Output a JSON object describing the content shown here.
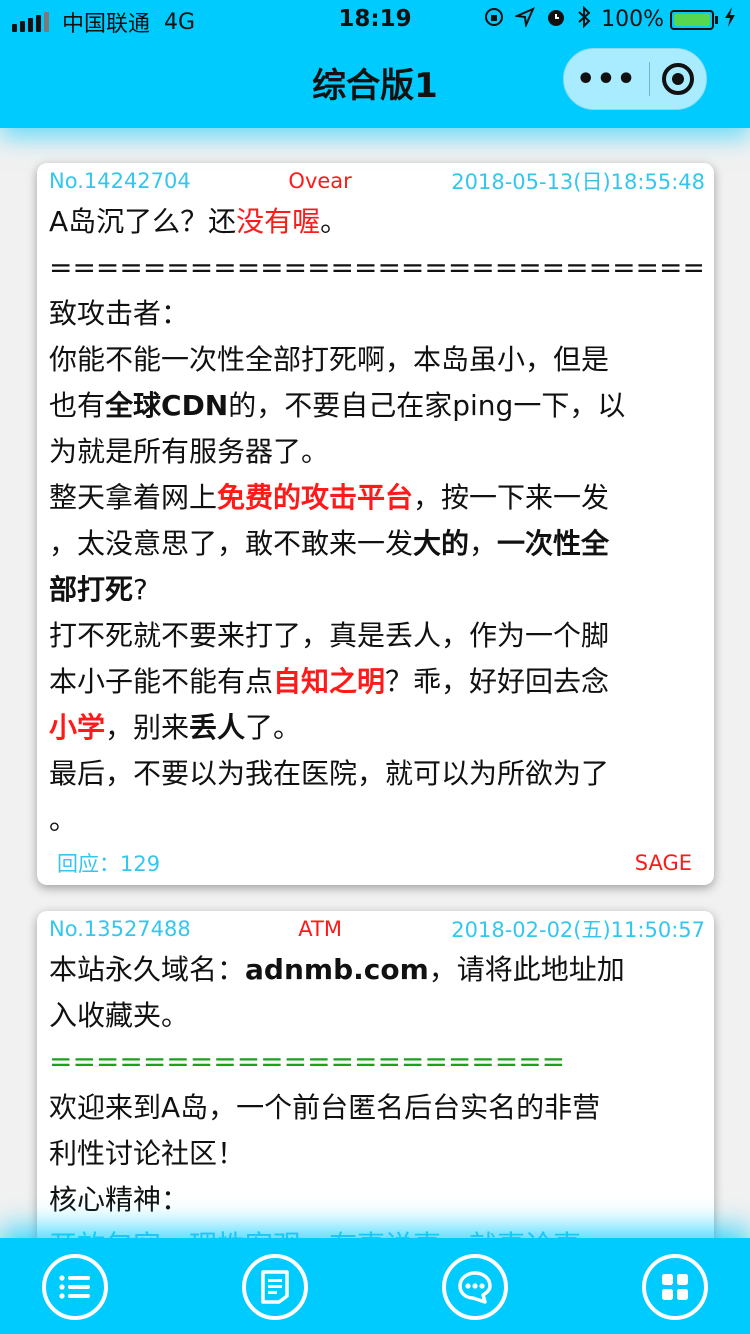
{
  "status_bar": {
    "carrier": "中国联通",
    "network": "4G",
    "time": "18:19",
    "battery": "100%"
  },
  "nav": {
    "title": "综合版1",
    "more_label": "•••"
  },
  "posts": [
    {
      "id": "No.14242704",
      "author": "Ovear",
      "date": "2018-05-13(日)18:55:48",
      "line1_a": "A岛沉了么？还",
      "line1_b": "没有喔",
      "line1_c": "。",
      "divider": "======================================",
      "l2": "致攻击者：",
      "l3": "你能不能一次性全部打死啊，本岛虽小，但是",
      "l4_a": "也有",
      "l4_b": "全球CDN",
      "l4_c": "的，不要自己在家ping一下，以",
      "l5": "为就是所有服务器了。",
      "l6_a": "整天拿着网上",
      "l6_b": "免费的攻击平台",
      "l6_c": "，按一下来一发",
      "l7_a": "，太没意思了，敢不敢来一发",
      "l7_b": "大的",
      "l7_c": "，",
      "l7_d": "一次性全",
      "l8_a": "部打死",
      "l8_b": "?",
      "l9": "打不死就不要来打了，真是丢人，作为一个脚",
      "l10_a": "本小子能不能有点",
      "l10_b": "自知之明",
      "l10_c": "？乖，好好回去念",
      "l11_a": "小学",
      "l11_b": "，别来",
      "l11_c": "丢人",
      "l11_d": "了。",
      "l12": "最后，不要以为我在医院，就可以为所欲为了",
      "l13": "。",
      "reply": "回应：129",
      "sage": "SAGE"
    },
    {
      "id": "No.13527488",
      "author": "ATM",
      "date": "2018-02-02(五)11:50:57",
      "l1_a": "本站永久域名：",
      "l1_b": "adnmb.com",
      "l1_c": "，请将此地址加",
      "l2": "入收藏夹。",
      "divider": "======================",
      "l3": "欢迎来到A岛，一个前台匿名后台实名的非营",
      "l4": "利性讨论社区！",
      "l5": "核心精神：",
      "l6": "开放包容、理性客观、有事说事、就事论事"
    }
  ],
  "tabs": [
    {
      "icon": "list-icon"
    },
    {
      "icon": "document-icon"
    },
    {
      "icon": "chat-icon"
    },
    {
      "icon": "grid-icon"
    }
  ],
  "colors": {
    "accent": "#00cbff",
    "red": "#ff1a1a",
    "meta": "#33c7ef",
    "green": "#1aa31a"
  }
}
